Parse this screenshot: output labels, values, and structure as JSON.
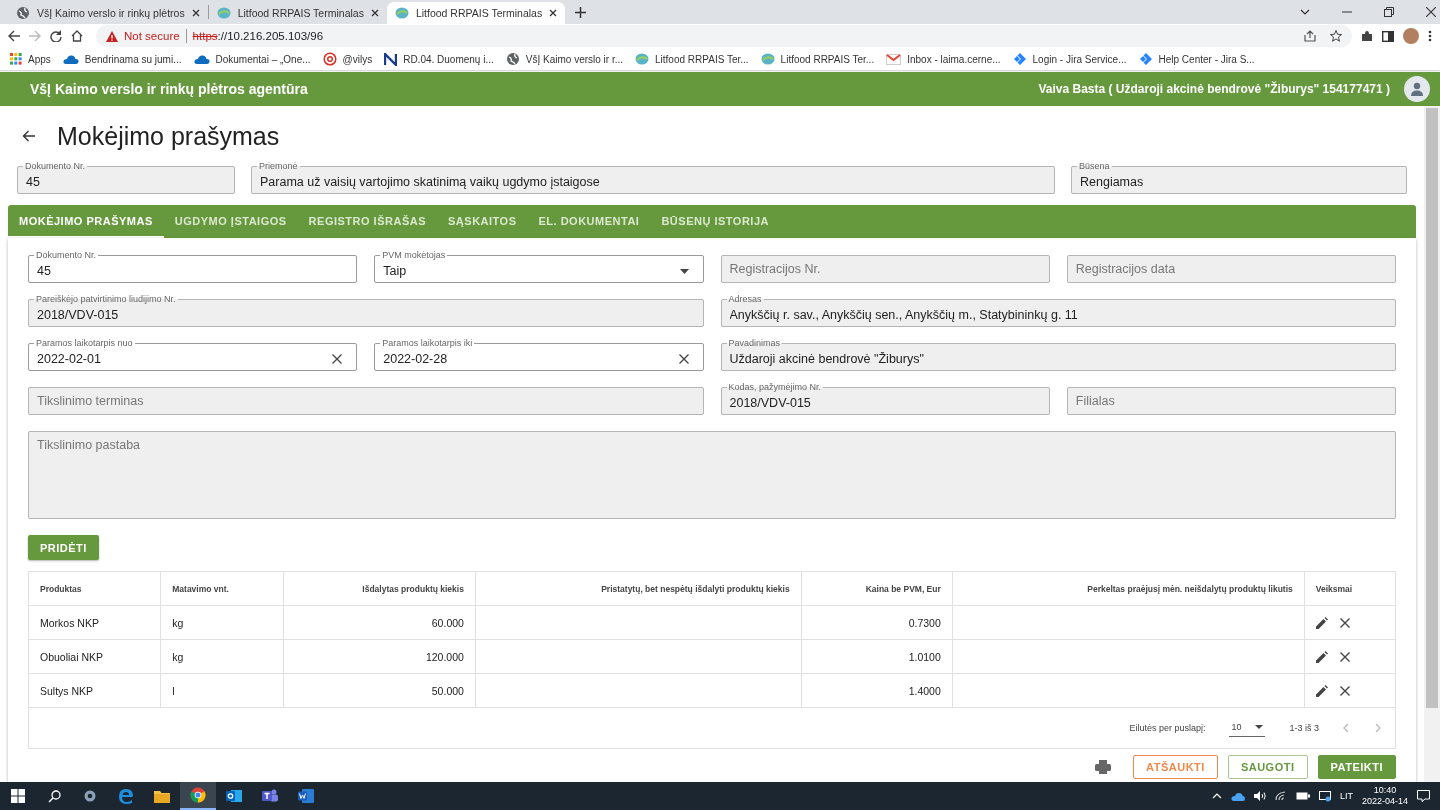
{
  "browser": {
    "tabs": [
      {
        "title": "VšĮ Kaimo verslo ir rinkų plėtros",
        "kind": "globe",
        "selected": false
      },
      {
        "title": "Litfood RRPAIS Terminalas",
        "kind": "litfood",
        "selected": false
      },
      {
        "title": "Litfood RRPAIS Terminalas",
        "kind": "litfood",
        "selected": true
      }
    ],
    "security_label": "Not secure",
    "url": {
      "scheme": "https",
      "rest": "://10.216.205.103/96",
      "insecure": true
    },
    "bookmarks": [
      {
        "label": "Apps",
        "kind": "apps"
      },
      {
        "label": "Bendrinama su jumi...",
        "kind": "cloud"
      },
      {
        "label": "Dokumentai – „One...",
        "kind": "cloud"
      },
      {
        "label": "@vilys",
        "kind": "at"
      },
      {
        "label": "RD.04. Duomenų i...",
        "kind": "square"
      },
      {
        "label": "VšĮ Kaimo verslo ir r...",
        "kind": "globe"
      },
      {
        "label": "Litfood RRPAIS Ter...",
        "kind": "litfood"
      },
      {
        "label": "Litfood RRPAIS Ter...",
        "kind": "litfood"
      },
      {
        "label": "Inbox - laima.cerne...",
        "kind": "mail"
      },
      {
        "label": "Login - Jira Service...",
        "kind": "jira"
      },
      {
        "label": "Help Center - Jira S...",
        "kind": "jira"
      }
    ]
  },
  "app_header": {
    "title": "VšĮ Kaimo verslo ir rinkų plėtros agentūra",
    "user": "Vaiva Basta ( Uždaroji akcinė bendrovė \"Žiburys\" 154177471 )"
  },
  "page_title": "Mokėjimo prašymas",
  "summary_fields": [
    {
      "label": "Dokumento Nr.",
      "value": "45",
      "disabled": true
    },
    {
      "label": "Priemonė",
      "value": "Parama už vaisių vartojimo skatinimą vaikų ugdymo įstaigose",
      "disabled": true
    },
    {
      "label": "Būsena",
      "value": "Rengiamas",
      "disabled": true
    }
  ],
  "panel": {
    "tabs": [
      {
        "label": "MOKĖJIMO PRAŠYMAS",
        "selected": true
      },
      {
        "label": "UGDYMO ĮSTAIGOS",
        "selected": false
      },
      {
        "label": "REGISTRO IŠRAŠAS",
        "selected": false
      },
      {
        "label": "SĄSKAITOS",
        "selected": false
      },
      {
        "label": "EL. DOKUMENTAI",
        "selected": false
      },
      {
        "label": "BŪSENŲ ISTORIJA",
        "selected": false
      }
    ],
    "fields": [
      {
        "kind": "text",
        "label": "Dokumento Nr.",
        "value": "45",
        "disabled": false
      },
      {
        "kind": "select",
        "label": "PVM mokėtojas",
        "value": "Taip",
        "disabled": false
      },
      {
        "kind": "text",
        "placeholder": "Registracijos Nr.",
        "disabled": true
      },
      {
        "kind": "text",
        "placeholder": "Registracijos data",
        "disabled": true
      },
      {
        "kind": "text",
        "label": "Pareiškėjo patvirtinimo liudijimo Nr.",
        "value": "2018/VDV-015",
        "disabled": true
      },
      {
        "kind": "text",
        "label": "Adresas",
        "value": "Anykščių r. sav., Anykščių sen., Anykščių m., Statybininkų g. 11",
        "disabled": true
      },
      {
        "kind": "date",
        "label": "Paramos laikotarpis nuo",
        "value": "2022-02-01",
        "disabled": false
      },
      {
        "kind": "date",
        "label": "Paramos laikotarpis iki",
        "value": "2022-02-28",
        "disabled": false
      },
      {
        "kind": "text",
        "label": "Pavadinimas",
        "value": "Uždaroji akcinė bendrovė \"Žiburys\"",
        "disabled": true
      },
      {
        "kind": "text",
        "placeholder": "Tikslinimo terminas",
        "disabled": true
      },
      {
        "kind": "text",
        "label": "Kodas, pažymėjimo Nr.",
        "value": "2018/VDV-015",
        "disabled": true
      },
      {
        "kind": "text",
        "placeholder": "Filialas",
        "disabled": true
      },
      {
        "kind": "textarea",
        "placeholder": "Tikslinimo pastaba",
        "disabled": true
      }
    ],
    "add_button": "PRIDĖTI",
    "table": {
      "columns": [
        {
          "label": "Produktas",
          "kind": "text"
        },
        {
          "label": "Matavimo vnt.",
          "kind": "text"
        },
        {
          "label": "Išdalytas produktų kiekis",
          "kind": "number"
        },
        {
          "label": "Pristatytų, bet nespėtų išdalyti produktų kiekis",
          "kind": "number"
        },
        {
          "label": "Kaina be PVM, Eur",
          "kind": "number"
        },
        {
          "label": "Perkeltas praėjusį mėn. neišdalytų produktų likutis",
          "kind": "number"
        },
        {
          "label": "Veiksmai",
          "kind": "actions"
        }
      ],
      "rows": [
        [
          "Morkos NKP",
          "kg",
          "60.000",
          "",
          "0.7300",
          ""
        ],
        [
          "Obuoliai NKP",
          "kg",
          "120.000",
          "",
          "1.0100",
          ""
        ],
        [
          "Sultys NKP",
          "l",
          "50.000",
          "",
          "1.4000",
          ""
        ]
      ],
      "pagination": {
        "rows_per_page_label": "Eilutės per puslapį:",
        "rows_per_page": "10",
        "range": "1-3 iš 3"
      }
    },
    "buttons": [
      {
        "label": "ATŠAUKTI",
        "kind": "cancel"
      },
      {
        "label": "SAUGOTI",
        "kind": "save"
      },
      {
        "label": "PATEIKTI",
        "kind": "submit"
      }
    ]
  },
  "taskbar": {
    "apps": [
      {
        "kind": "settings",
        "selected": false
      },
      {
        "kind": "edge",
        "selected": false
      },
      {
        "kind": "folder",
        "selected": false
      },
      {
        "kind": "chrome",
        "selected": true
      },
      {
        "kind": "outlook",
        "selected": false
      },
      {
        "kind": "teams",
        "selected": false
      },
      {
        "kind": "word",
        "selected": false
      }
    ],
    "language": "LIT",
    "time": "10:40",
    "date": "2022-04-14"
  }
}
